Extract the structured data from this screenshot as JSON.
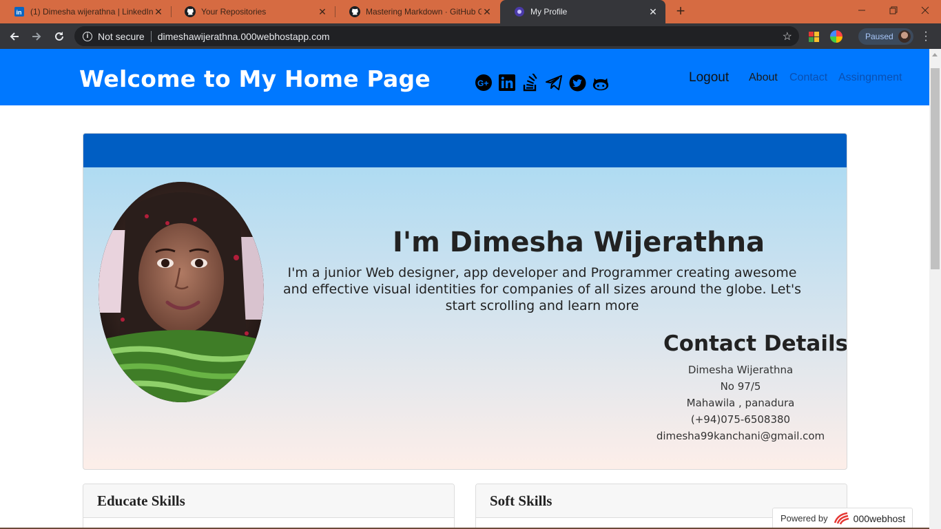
{
  "browser": {
    "tabs": [
      {
        "title": "(1) Dimesha wijerathna | LinkedIn",
        "icon": "linkedin-icon",
        "active": false
      },
      {
        "title": "Your Repositories",
        "icon": "github-icon",
        "active": false
      },
      {
        "title": "Mastering Markdown · GitHub Gu",
        "icon": "github-icon",
        "active": false
      },
      {
        "title": "My Profile",
        "icon": "site-icon",
        "active": true
      }
    ],
    "security_label": "Not secure",
    "url": "dimeshawijerathna.000webhostapp.com",
    "profile_label": "Paused",
    "colors": {
      "tabstrip": "#d66b42",
      "toolbar": "#35363a"
    }
  },
  "site": {
    "title": "Welcome to My Home Page",
    "social_icons": [
      "google-plus-icon",
      "linkedin-icon",
      "stack-overflow-icon",
      "telegram-icon",
      "twitter-icon",
      "github-icon"
    ],
    "nav": {
      "logout": "Logout",
      "about": "About",
      "contact": "Contact",
      "assignment": "Assingnment"
    },
    "colors": {
      "header": "#0078ff",
      "card_header": "#005ec3"
    }
  },
  "profile": {
    "greeting": "I'm Dimesha Wijerathna",
    "intro": "I'm a junior Web designer, app developer and Programmer creating awesome and effective visual identities for companies of all sizes around the globe. Let's start scrolling and learn more",
    "contact_heading": "Contact Details",
    "contact": {
      "name": "Dimesha Wijerathna",
      "address1": "No 97/5",
      "address2": "Mahawila , panadura",
      "phone": "(+94)075-6508380",
      "email": "dimesha99kanchani@gmail.com"
    }
  },
  "skills": {
    "educate_title": "Educate Skills",
    "soft_title": "Soft Skills"
  },
  "footer": {
    "powered_by": "Powered by",
    "brand": "000webhost"
  }
}
